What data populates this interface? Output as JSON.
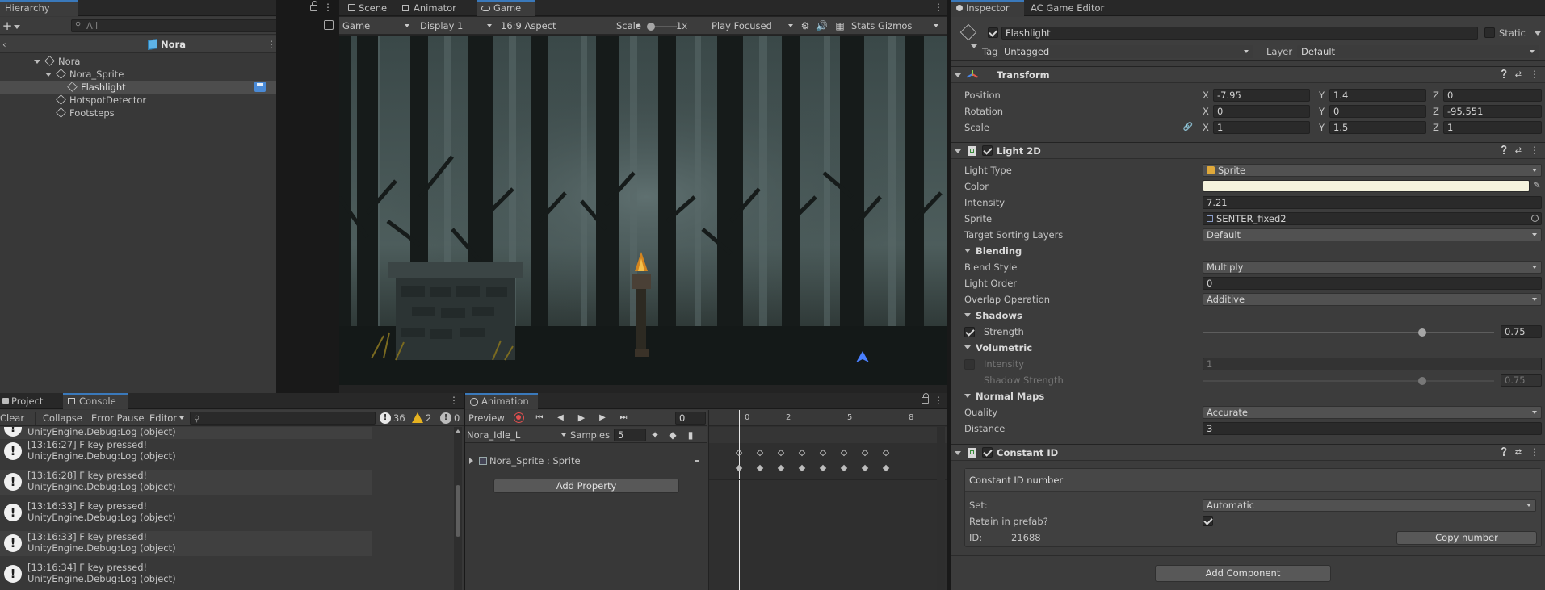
{
  "hierarchy": {
    "tab": "Hierarchy",
    "search_placeholder": "All",
    "scene_title": "Nora",
    "items": [
      {
        "label": "Nora",
        "depth": 0
      },
      {
        "label": "Nora_Sprite",
        "depth": 1
      },
      {
        "label": "Flashlight",
        "depth": 2
      },
      {
        "label": "HotspotDetector",
        "depth": 1
      },
      {
        "label": "Footsteps",
        "depth": 1
      }
    ]
  },
  "game_view": {
    "tabs": [
      "Scene",
      "Animator",
      "Game"
    ],
    "active_tab": "Game",
    "toolbar": {
      "mode": "Game",
      "display": "Display 1",
      "aspect": "16:9 Aspect",
      "scale_label": "Scale",
      "scale_value": "1x",
      "play_mode": "Play Focused",
      "stats": "Stats",
      "gizmos": "Gizmos"
    }
  },
  "console": {
    "tabs": [
      "Project",
      "Console"
    ],
    "active_tab": "Console",
    "toolbar": {
      "clear": "Clear",
      "collapse": "Collapse",
      "error_pause": "Error Pause",
      "editor": "Editor"
    },
    "counts": {
      "log": "36",
      "warning": "2",
      "error": "0"
    },
    "first_line_partial": "UnityEngine.Debug:Log (object)",
    "entries": [
      {
        "line1": "[13:16:27] F key pressed!",
        "line2": "UnityEngine.Debug:Log (object)"
      },
      {
        "line1": "[13:16:28] F key pressed!",
        "line2": "UnityEngine.Debug:Log (object)"
      },
      {
        "line1": "[13:16:33] F key pressed!",
        "line2": "UnityEngine.Debug:Log (object)"
      },
      {
        "line1": "[13:16:33] F key pressed!",
        "line2": "UnityEngine.Debug:Log (object)"
      },
      {
        "line1": "[13:16:34] F key pressed!",
        "line2": "UnityEngine.Debug:Log (object)"
      }
    ]
  },
  "animation": {
    "tab": "Animation",
    "preview": "Preview",
    "frame": "0",
    "clip": "Nora_Idle_L",
    "samples_label": "Samples",
    "samples_value": "5",
    "property": "Nora_Sprite : Sprite",
    "add_property": "Add Property",
    "timeline_labels": [
      "0",
      "2",
      "5",
      "8"
    ]
  },
  "inspector": {
    "tabs": [
      "Inspector",
      "AC Game Editor"
    ],
    "object_name": "Flashlight",
    "static_label": "Static",
    "tag_label": "Tag",
    "tag_value": "Untagged",
    "layer_label": "Layer",
    "layer_value": "Default",
    "transform": {
      "title": "Transform",
      "position_label": "Position",
      "rotation_label": "Rotation",
      "scale_label": "Scale",
      "axis": [
        "X",
        "Y",
        "Z"
      ],
      "position": [
        "-7.95",
        "1.4",
        "0"
      ],
      "rotation": [
        "0",
        "0",
        "-95.551"
      ],
      "scale": [
        "1",
        "1.5",
        "1"
      ]
    },
    "light2d": {
      "title": "Light 2D",
      "light_type_label": "Light Type",
      "light_type": "Sprite",
      "color_label": "Color",
      "color": "#f5f3dd",
      "intensity_label": "Intensity",
      "intensity": "7.21",
      "sprite_label": "Sprite",
      "sprite": "SENTER_fixed2",
      "sorting_label": "Target Sorting Layers",
      "sorting": "Default",
      "blending": "Blending",
      "blend_style_label": "Blend Style",
      "blend_style": "Multiply",
      "light_order_label": "Light Order",
      "light_order": "0",
      "overlap_label": "Overlap Operation",
      "overlap": "Additive",
      "shadows": "Shadows",
      "strength_label": "Strength",
      "strength": "0.75",
      "volumetric": "Volumetric",
      "vol_intensity_label": "Intensity",
      "vol_intensity": "1",
      "shadow_strength_label": "Shadow Strength",
      "shadow_strength": "0.75",
      "normal_maps": "Normal Maps",
      "quality_label": "Quality",
      "quality": "Accurate",
      "distance_label": "Distance",
      "distance": "3"
    },
    "constant_id": {
      "title": "Constant ID",
      "box_title": "Constant ID number",
      "set_label": "Set:",
      "set_value": "Automatic",
      "retain_label": "Retain in prefab?",
      "id_label": "ID:",
      "id_value": "21688",
      "copy_button": "Copy number"
    },
    "add_component": "Add Component"
  }
}
